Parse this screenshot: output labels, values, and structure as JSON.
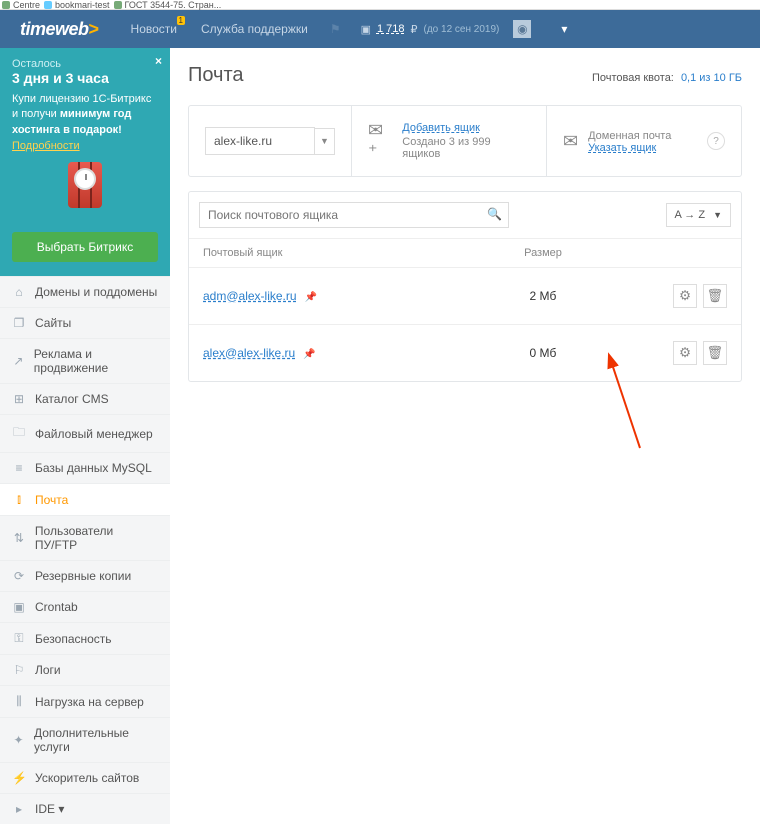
{
  "browser_tabs": [
    "Centre",
    "bookmari-test",
    "ГОСТ 3544-75. Стран..."
  ],
  "logo": "timeweb",
  "top_links": {
    "news": "Новости",
    "news_badge": "1",
    "support": "Служба поддержки"
  },
  "balance": {
    "amount": "1 718",
    "currency": "₽",
    "until": "(до 12 сен 2019)"
  },
  "promo": {
    "pre": "Осталось",
    "time": "3 дня и 3 часа",
    "text1": "Купи лицензию 1С-Битрикс и получи ",
    "text_bold1": "минимум год хостинга в подарок!",
    "details": "Подробности",
    "button": "Выбрать Битрикс"
  },
  "menu": [
    {
      "icon": "⌂",
      "label": "Домены и поддомены"
    },
    {
      "icon": "❐",
      "label": "Сайты"
    },
    {
      "icon": "↗",
      "label": "Реклама и продвижение"
    },
    {
      "icon": "⊞",
      "label": "Каталог CMS"
    },
    {
      "icon": "🗀",
      "label": "Файловый менеджер"
    },
    {
      "icon": "≡",
      "label": "Базы данных MySQL"
    },
    {
      "icon": "⫾",
      "label": "Почта",
      "active": true
    },
    {
      "icon": "⇅",
      "label": "Пользователи ПУ/FTP"
    },
    {
      "icon": "⟳",
      "label": "Резервные копии"
    },
    {
      "icon": "▣",
      "label": "Crontab"
    },
    {
      "icon": "⚿",
      "label": "Безопасность"
    },
    {
      "icon": "⚐",
      "label": "Логи"
    },
    {
      "icon": "⫼",
      "label": "Нагрузка на сервер"
    },
    {
      "icon": "✦",
      "label": "Дополнительные услуги"
    },
    {
      "icon": "⚡",
      "label": "Ускоритель сайтов"
    },
    {
      "icon": "▸",
      "label": "IDE ▾"
    }
  ],
  "page": {
    "title": "Почта",
    "quota_label": "Почтовая квота:",
    "quota_value": "0,1 из 10 ГБ"
  },
  "domain_panel": {
    "selected": "alex-like.ru",
    "add_link": "Добавить ящик",
    "add_sub": "Создано 3 из 999 ящиков",
    "dom_label": "Доменная почта",
    "dom_link": "Указать ящик"
  },
  "filter": {
    "search_placeholder": "Поиск почтового ящика",
    "sort": "A → Z"
  },
  "table": {
    "col_name": "Почтовый ящик",
    "col_size": "Размер",
    "rows": [
      {
        "email": "adm@alex-like.ru",
        "size": "2 Мб"
      },
      {
        "email": "alex@alex-like.ru",
        "size": "0 Мб"
      }
    ]
  }
}
